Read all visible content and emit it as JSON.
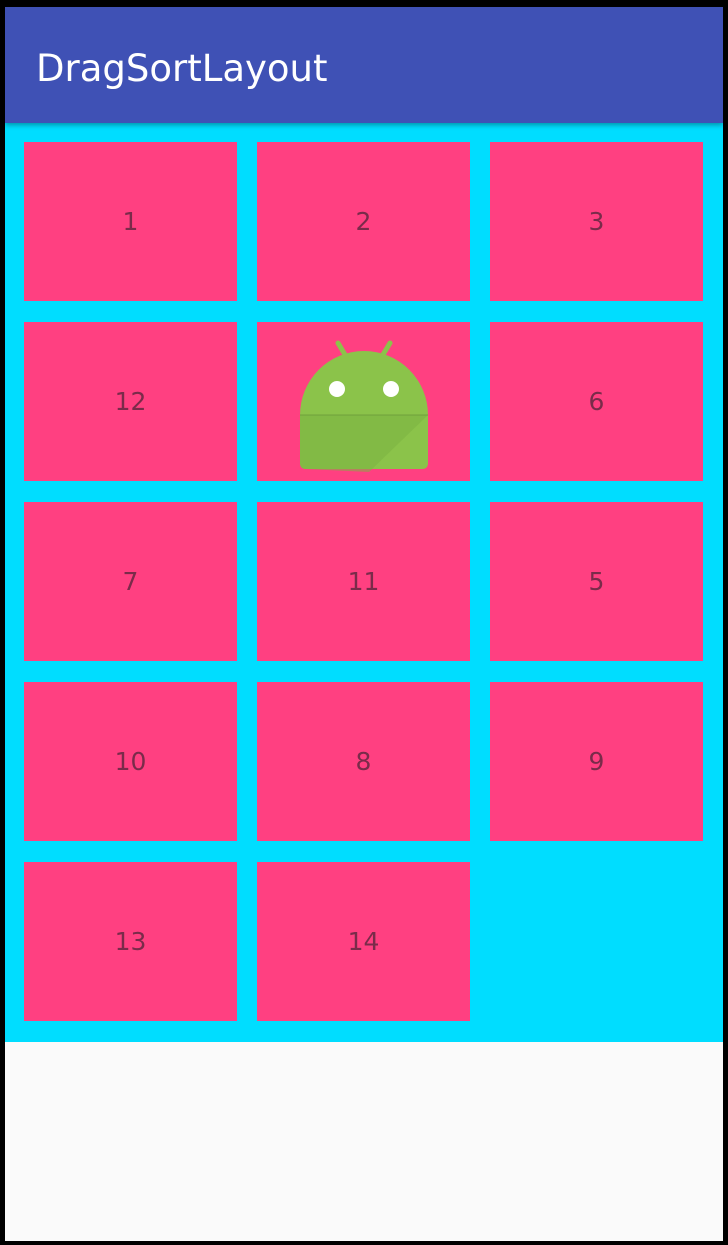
{
  "app_bar": {
    "title": "DragSortLayout",
    "color": "#3f51b5"
  },
  "grid": {
    "background_color": "#00ddff",
    "tile_color": "#ff4081",
    "tiles": [
      {
        "label": "1"
      },
      {
        "label": "2"
      },
      {
        "label": "3"
      },
      {
        "label": "12"
      },
      {
        "label": "",
        "icon": "android-launcher-icon"
      },
      {
        "label": "6"
      },
      {
        "label": "7"
      },
      {
        "label": "11"
      },
      {
        "label": "5"
      },
      {
        "label": "10"
      },
      {
        "label": "8"
      },
      {
        "label": "9"
      },
      {
        "label": "13"
      },
      {
        "label": "14"
      }
    ]
  }
}
